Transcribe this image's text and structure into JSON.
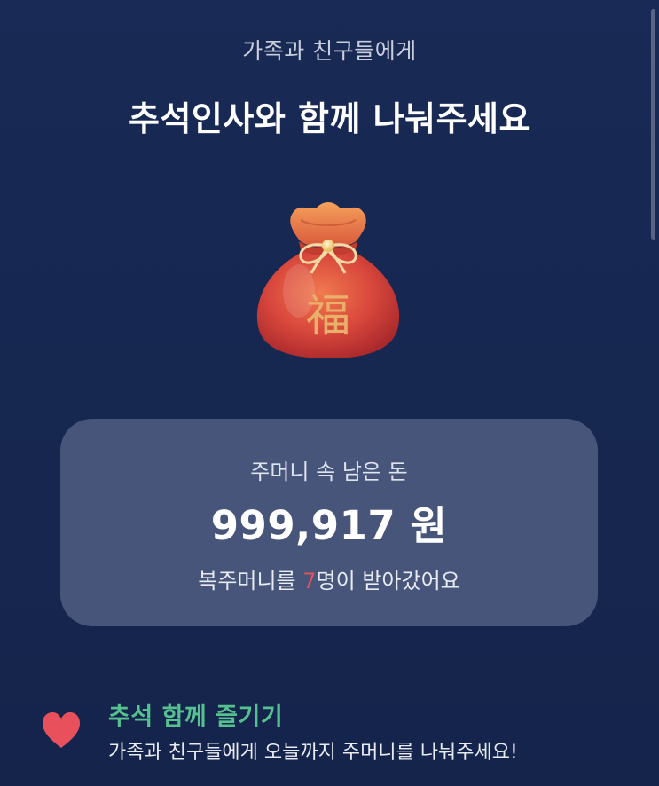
{
  "header": {
    "subtitle": "가족과 친구들에게",
    "title": "추석인사와 함께 나눠주세요"
  },
  "pouch": {
    "character": "福",
    "icon": "lucky-pouch-icon"
  },
  "card": {
    "label": "주머니 속 남은 돈",
    "amount": "999,917 원",
    "status_prefix": "복주머니를 ",
    "status_count": "7",
    "status_suffix": "명이 받아갔어요",
    "count_color": "#e0535a"
  },
  "promo": {
    "icon": "heart-icon",
    "title": "추석 함께 즐기기",
    "description": "가족과 친구들에게 오늘까지 주머니를 나눠주세요!",
    "title_color": "#56c190",
    "icon_color": "#e8515b"
  },
  "colors": {
    "background": "#172853",
    "card": "#47557a"
  }
}
